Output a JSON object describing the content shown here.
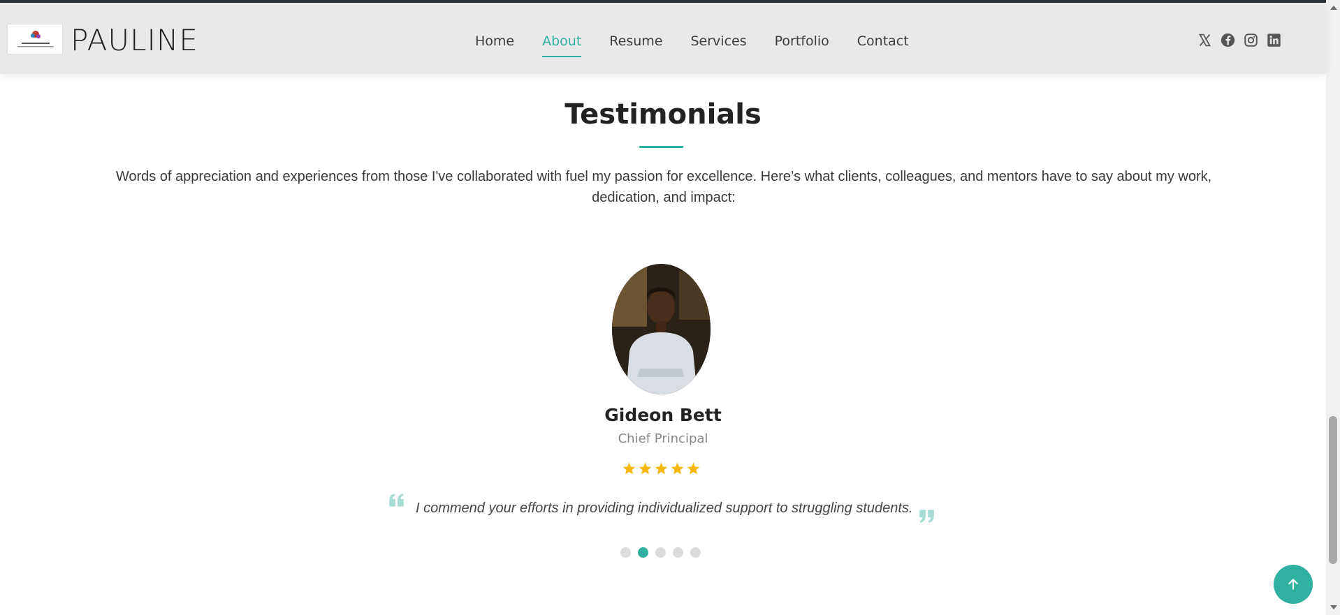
{
  "header": {
    "brand": "PAULINE",
    "nav": [
      "Home",
      "About",
      "Resume",
      "Services",
      "Portfolio",
      "Contact"
    ],
    "active_nav": "About",
    "socials": [
      "x-icon",
      "facebook-icon",
      "instagram-icon",
      "linkedin-icon"
    ]
  },
  "section": {
    "title": "Testimonials",
    "intro": "Words of appreciation and experiences from those I've collaborated with fuel my passion for excellence. Here’s what clients, colleagues, and mentors have to say about my work, dedication, and impact:"
  },
  "testimonial": {
    "name": "Gideon Bett",
    "role": "Chief Principal",
    "rating": 5,
    "rating_max": 5,
    "quote": "I commend your efforts in providing individualized support to struggling students."
  },
  "carousel": {
    "count": 5,
    "active_index": 1
  },
  "colors": {
    "accent": "#2fb0a0",
    "star": "#f6b70f",
    "header_bg": "#e9e9e9"
  },
  "icons": {
    "back_to_top": "arrow-up-icon"
  }
}
